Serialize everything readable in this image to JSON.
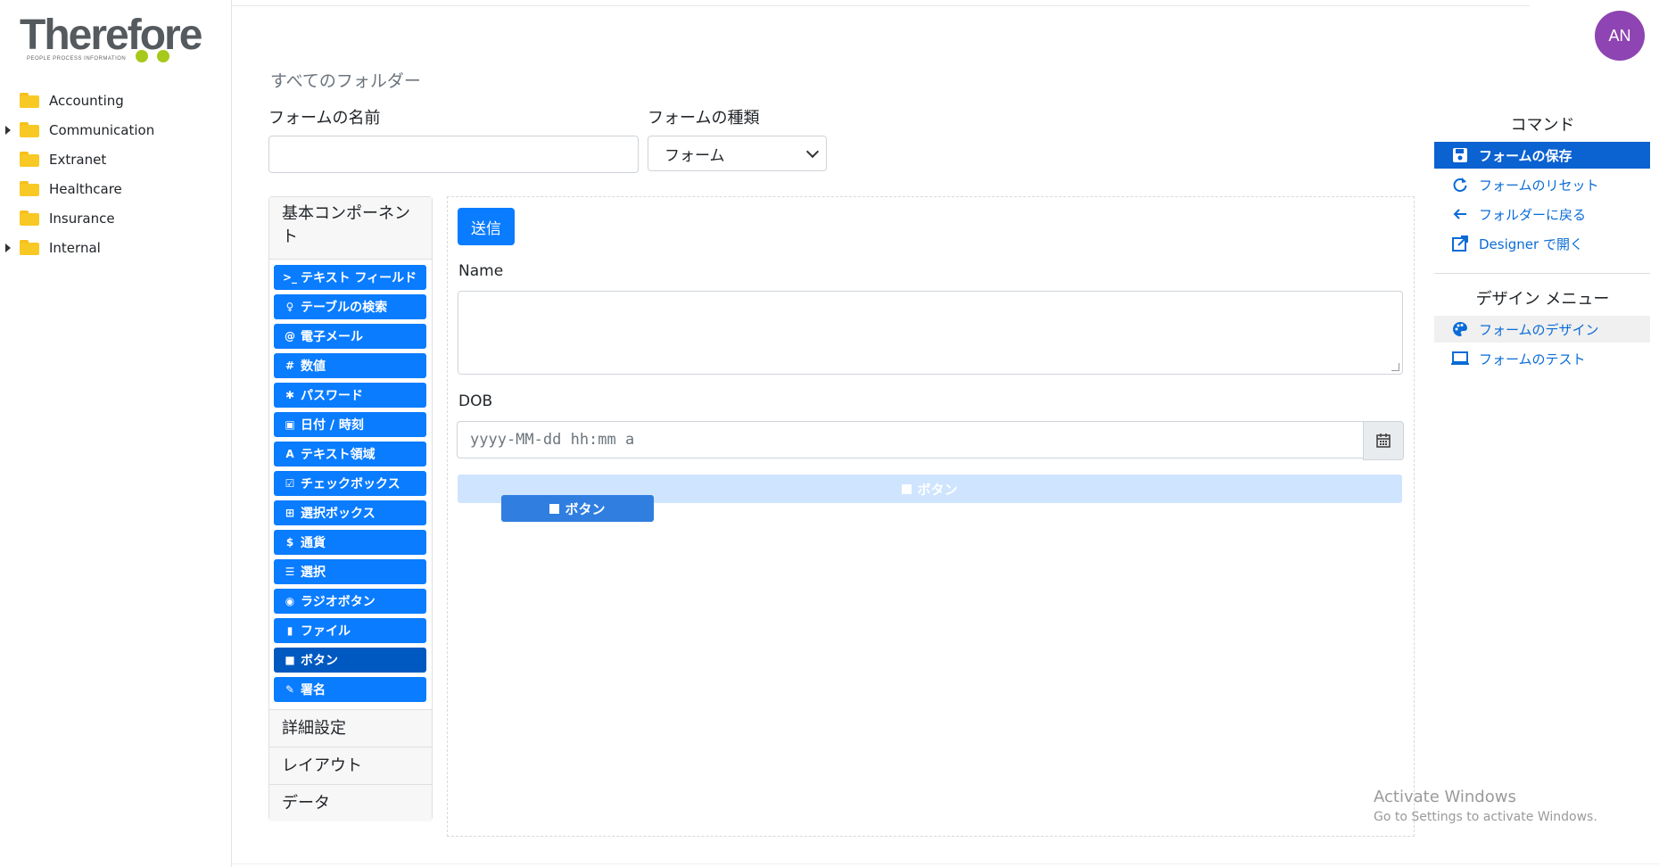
{
  "app": {
    "logo_text": "Therefore",
    "logo_tagline": "PEOPLE  PROCESS  INFORMATION",
    "user_initials": "AN"
  },
  "colors": {
    "accent": "#0a7cff",
    "selected": "#0b62d1",
    "avatar": "#8e44b2",
    "folder": "#f8c824",
    "logo_dots": "#a6c91b"
  },
  "sidebar": {
    "folders": [
      {
        "label": "Accounting",
        "expandable": false
      },
      {
        "label": "Communication",
        "expandable": true
      },
      {
        "label": "Extranet",
        "expandable": false
      },
      {
        "label": "Healthcare",
        "expandable": false
      },
      {
        "label": "Insurance",
        "expandable": false
      },
      {
        "label": "Internal",
        "expandable": true
      }
    ]
  },
  "header": {
    "breadcrumb": "すべてのフォルダー",
    "form_name_label": "フォームの名前",
    "form_name_value": "",
    "form_type_label": "フォームの種類",
    "form_type_value": "フォーム"
  },
  "components": {
    "title": "基本コンポーネント",
    "items": [
      {
        "icon": "terminal-icon",
        "glyph": ">_",
        "label": "テキスト フィールド"
      },
      {
        "icon": "lightbulb-icon",
        "glyph": "♀",
        "label": "テーブルの検索"
      },
      {
        "icon": "at-icon",
        "glyph": "@",
        "label": "電子メール"
      },
      {
        "icon": "hash-icon",
        "glyph": "#",
        "label": "数値"
      },
      {
        "icon": "asterisk-icon",
        "glyph": "✱",
        "label": "パスワード"
      },
      {
        "icon": "calendar-icon",
        "glyph": "▣",
        "label": "日付 / 時刻"
      },
      {
        "icon": "font-icon",
        "glyph": "A",
        "label": "テキスト領域"
      },
      {
        "icon": "check-square-icon",
        "glyph": "☑",
        "label": "チェックボックス"
      },
      {
        "icon": "plus-square-icon",
        "glyph": "⊞",
        "label": "選択ボックス"
      },
      {
        "icon": "dollar-icon",
        "glyph": "$",
        "label": "通貨"
      },
      {
        "icon": "list-icon",
        "glyph": "☰",
        "label": "選択"
      },
      {
        "icon": "dot-circle-icon",
        "glyph": "◉",
        "label": "ラジオボタン"
      },
      {
        "icon": "file-icon",
        "glyph": "▮",
        "label": "ファイル"
      },
      {
        "icon": "stop-icon",
        "glyph": "■",
        "label": "ボタン"
      },
      {
        "icon": "pencil-icon",
        "glyph": "✎",
        "label": "署名"
      }
    ],
    "active_item": "ボタン",
    "sections": [
      "詳細設定",
      "レイアウト",
      "データ"
    ]
  },
  "canvas": {
    "submit_label": "送信",
    "name_label": "Name",
    "dob_label": "DOB",
    "dob_placeholder": "yyyy-MM-dd hh:mm a",
    "placeholder_button_label": "ボタン",
    "dragging_button_label": "ボタン"
  },
  "commands": {
    "title": "コマンド",
    "items": [
      {
        "icon": "save-icon",
        "label": "フォームの保存"
      },
      {
        "icon": "reset-icon",
        "label": "フォームのリセット"
      },
      {
        "icon": "arrow-left-icon",
        "label": "フォルダーに戻る"
      },
      {
        "icon": "external-link-icon",
        "label": "Designer で開く"
      }
    ],
    "selected_index": 0
  },
  "design_menu": {
    "title": "デザイン メニュー",
    "items": [
      {
        "icon": "palette-icon",
        "label": "フォームのデザイン"
      },
      {
        "icon": "laptop-icon",
        "label": "フォームのテスト"
      }
    ],
    "active_index": 0
  },
  "watermark": {
    "line1": "Activate Windows",
    "line2": "Go to Settings to activate Windows."
  }
}
